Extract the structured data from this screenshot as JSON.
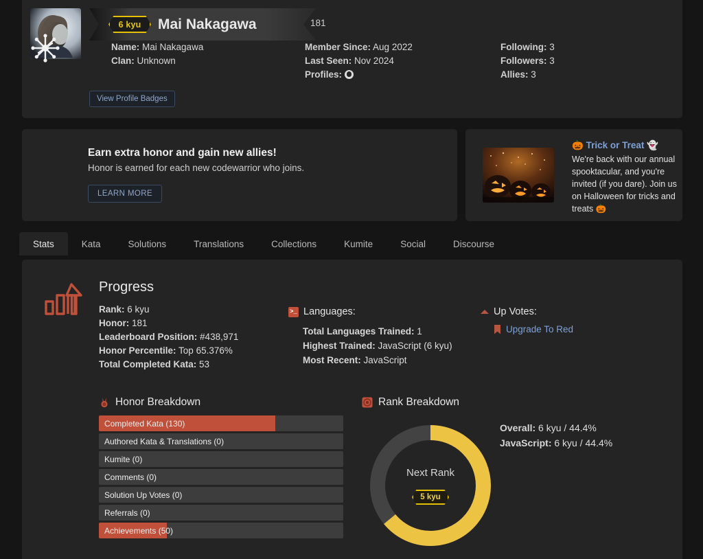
{
  "profile": {
    "rank_badge": "6 kyu",
    "username": "Mai Nakagawa",
    "honor_top": "181",
    "name_key": "Name:",
    "name_value": "Mai Nakagawa",
    "clan_key": "Clan:",
    "clan_value": "Unknown",
    "member_since_key": "Member Since:",
    "member_since_value": "Aug 2022",
    "last_seen_key": "Last Seen:",
    "last_seen_value": "Nov 2024",
    "profiles_key": "Profiles:",
    "profiles_icon": "github-icon",
    "following_key": "Following:",
    "following_value": "3",
    "followers_key": "Followers:",
    "followers_value": "3",
    "allies_key": "Allies:",
    "allies_value": "3",
    "badges_button": "View Profile Badges"
  },
  "honor_banner": {
    "icon": "allies-burst-icon",
    "title": "Earn extra honor and gain new allies!",
    "subtitle": "Honor is earned for each new codewarrior who joins.",
    "button": "LEARN MORE"
  },
  "promo": {
    "image_alt": "halloween-pumpkins-image",
    "title_prefix": "🎃",
    "title": "Trick or Treat",
    "title_suffix": "👻",
    "body": "We're back with our annual spooktacular, and you're invited (if you dare). Join us on Halloween for tricks and treats 🎃"
  },
  "tabs": [
    {
      "label": "Stats",
      "active": true
    },
    {
      "label": "Kata",
      "active": false
    },
    {
      "label": "Solutions",
      "active": false
    },
    {
      "label": "Translations",
      "active": false
    },
    {
      "label": "Collections",
      "active": false
    },
    {
      "label": "Kumite",
      "active": false
    },
    {
      "label": "Social",
      "active": false
    },
    {
      "label": "Discourse",
      "active": false
    }
  ],
  "progress": {
    "heading": "Progress",
    "icon": "bar-chart-up-icon",
    "rank_key": "Rank:",
    "rank_value": "6 kyu",
    "honor_key": "Honor:",
    "honor_value": "181",
    "leaderboard_key": "Leaderboard Position:",
    "leaderboard_value": "#438,971",
    "percentile_key": "Honor Percentile:",
    "percentile_value": "Top 65.376%",
    "completed_key": "Total Completed Kata:",
    "completed_value": "53"
  },
  "languages": {
    "heading": "Languages:",
    "icon": "terminal-icon",
    "total_key": "Total Languages Trained:",
    "total_value": "1",
    "highest_key": "Highest Trained:",
    "highest_value": "JavaScript (6 kyu)",
    "recent_key": "Most Recent:",
    "recent_value": "JavaScript"
  },
  "upvotes": {
    "heading": "Up Votes:",
    "icon": "caret-up-icon",
    "link_icon": "ribbon-icon",
    "link": "Upgrade To Red"
  },
  "chart_data": [
    {
      "type": "bar",
      "title": "Honor Breakdown",
      "icon": "medal-icon",
      "orientation": "horizontal",
      "categories": [
        "Completed Kata (130)",
        "Authored Kata & Translations (0)",
        "Kumite (0)",
        "Comments (0)",
        "Solution Up Votes (0)",
        "Referrals (0)",
        "Achievements (50)"
      ],
      "values": [
        130,
        0,
        0,
        0,
        0,
        0,
        50
      ],
      "percents": [
        72.2,
        0,
        0,
        0,
        0,
        0,
        27.8
      ],
      "xlabel": "",
      "ylabel": "",
      "xlim": [
        0,
        180
      ],
      "grid": false,
      "legend": "none",
      "bar_color": "#c0503a",
      "track_color": "#3d3d3d"
    },
    {
      "type": "pie",
      "title": "Rank Breakdown",
      "icon": "target-icon",
      "subtype": "donut",
      "center_label": "Next Rank",
      "center_badge": "5 kyu",
      "slices": [
        {
          "name": "Progress to next rank",
          "value": 64.0,
          "color": "#edc343"
        },
        {
          "name": "Remaining",
          "value": 36.0,
          "color": "#434343"
        }
      ],
      "legend_position": "right",
      "legend": [
        {
          "key": "Overall:",
          "value": "6 kyu / 44.4%"
        },
        {
          "key": "JavaScript:",
          "value": "6 kyu / 44.4%"
        }
      ]
    }
  ],
  "colors": {
    "page_bg": "#151515",
    "panel_bg": "#242424",
    "accent_red": "#c0503a",
    "accent_yellow": "#e5c100",
    "link_blue": "#7ea1d8"
  }
}
